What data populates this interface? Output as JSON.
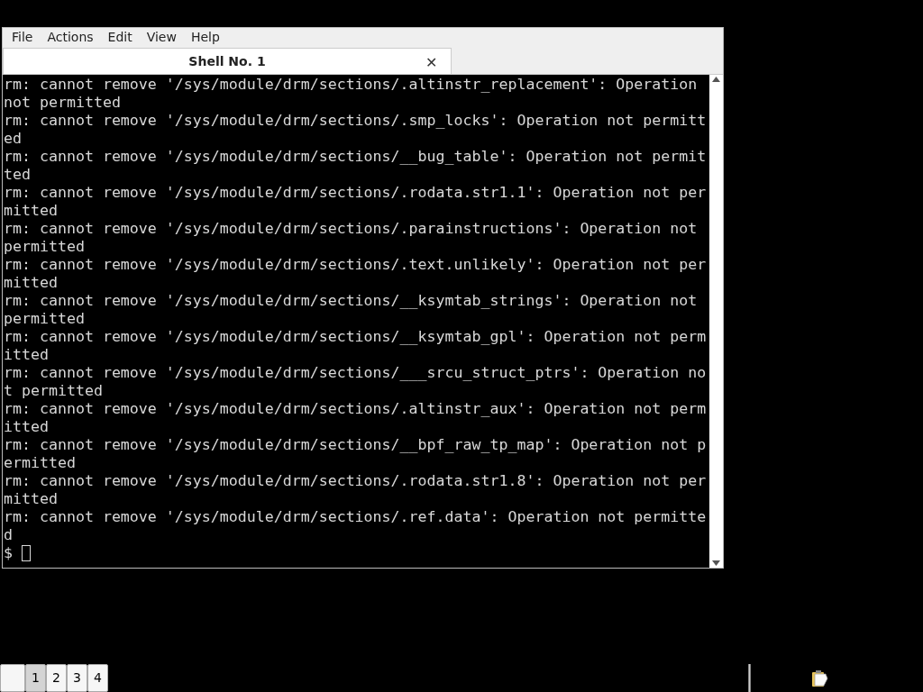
{
  "menu": [
    "File",
    "Actions",
    "Edit",
    "View",
    "Help"
  ],
  "tab": {
    "title": "Shell No. 1",
    "close": "✕"
  },
  "terminal": {
    "lines": [
      "rm: cannot remove '/sys/module/drm/sections/.altinstr_replacement': Operation",
      "not permitted",
      "rm: cannot remove '/sys/module/drm/sections/.smp_locks': Operation not permitt",
      "ed",
      "rm: cannot remove '/sys/module/drm/sections/__bug_table': Operation not permit",
      "ted",
      "rm: cannot remove '/sys/module/drm/sections/.rodata.str1.1': Operation not per",
      "mitted",
      "rm: cannot remove '/sys/module/drm/sections/.parainstructions': Operation not",
      "permitted",
      "rm: cannot remove '/sys/module/drm/sections/.text.unlikely': Operation not per",
      "mitted",
      "rm: cannot remove '/sys/module/drm/sections/__ksymtab_strings': Operation not",
      "permitted",
      "rm: cannot remove '/sys/module/drm/sections/__ksymtab_gpl': Operation not perm",
      "itted",
      "rm: cannot remove '/sys/module/drm/sections/___srcu_struct_ptrs': Operation no",
      "t permitted",
      "rm: cannot remove '/sys/module/drm/sections/.altinstr_aux': Operation not perm",
      "itted",
      "rm: cannot remove '/sys/module/drm/sections/__bpf_raw_tp_map': Operation not p",
      "ermitted",
      "rm: cannot remove '/sys/module/drm/sections/.rodata.str1.8': Operation not per",
      "mitted",
      "rm: cannot remove '/sys/module/drm/sections/.ref.data': Operation not permitte",
      "d"
    ],
    "prompt": "$"
  },
  "pager": [
    {
      "selected": false
    },
    {
      "label": "1",
      "selected": true
    },
    {
      "label": "2",
      "selected": false
    },
    {
      "label": "3",
      "selected": false
    },
    {
      "label": "4",
      "selected": false
    }
  ]
}
